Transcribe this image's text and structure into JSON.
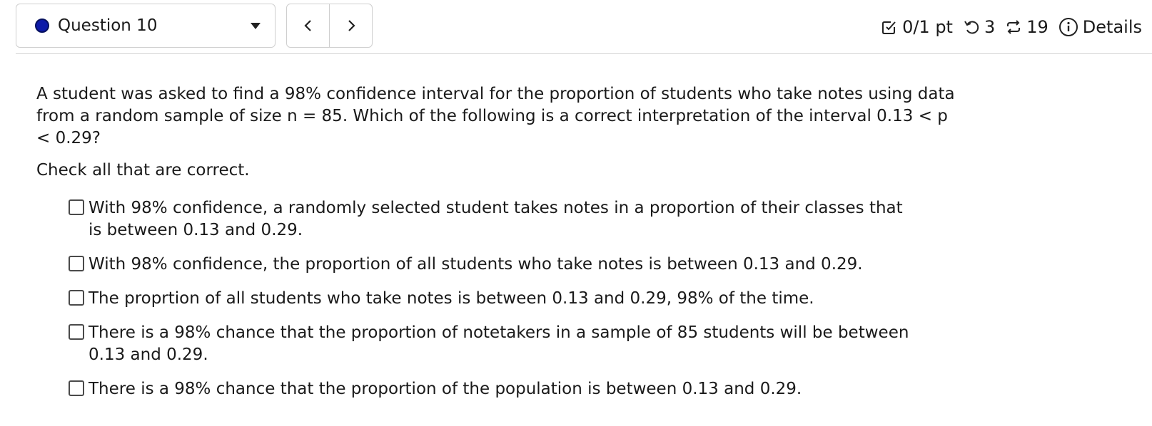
{
  "header": {
    "question_label": "Question 10",
    "score": "0/1 pt",
    "attempts": "3",
    "versions": "19",
    "details_label": "Details"
  },
  "question": {
    "text": "A student was asked to find a 98% confidence interval for the proportion of students who take notes using data from a random sample of size n = 85. Which of the following is a correct interpretation of the interval 0.13 < p < 0.29?",
    "instruction": "Check all that are correct."
  },
  "options": [
    {
      "label": "With 98% confidence, a randomly selected student takes notes in a proportion of their classes that is between 0.13 and 0.29.",
      "checked": false
    },
    {
      "label": "With 98% confidence, the proportion of all students who take notes is between 0.13 and 0.29.",
      "checked": false
    },
    {
      "label": "The proprtion of all students who take notes is between 0.13 and 0.29, 98% of the time.",
      "checked": false
    },
    {
      "label": "There is a 98% chance that the proportion of notetakers in a sample of 85 students will be between 0.13 and 0.29.",
      "checked": false
    },
    {
      "label": "There is a 98% chance that the proportion of the population is between 0.13 and 0.29.",
      "checked": false
    }
  ],
  "colors": {
    "status_dot": "#0d1aa8",
    "border": "#cfcfcf",
    "text": "#1a1a1a"
  },
  "icons": {
    "status": "status-dot-icon",
    "dropdown": "caret-down-icon",
    "prev": "chevron-left-icon",
    "next": "chevron-right-icon",
    "score": "checkbox-checked-icon",
    "attempts": "retry-icon",
    "versions": "repeat-icon",
    "details": "info-icon"
  }
}
